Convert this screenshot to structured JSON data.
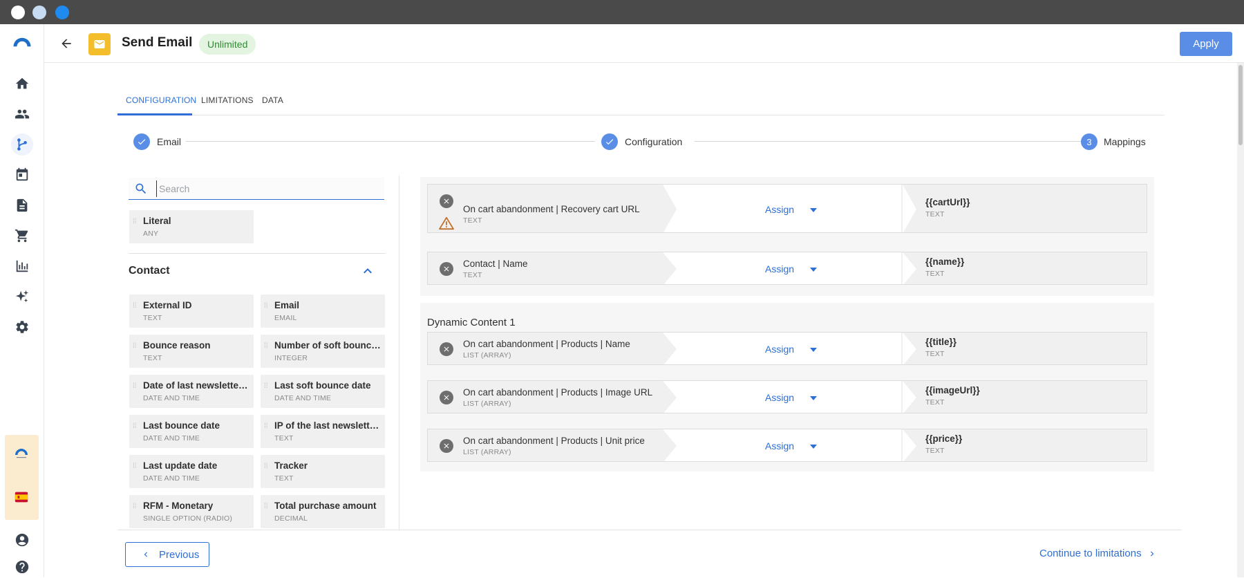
{
  "header": {
    "title": "Send Email",
    "badge": "Unlimited",
    "apply_label": "Apply"
  },
  "tabs": [
    {
      "label": "CONFIGURATION",
      "active": true
    },
    {
      "label": "LIMITATIONS",
      "active": false
    },
    {
      "label": "DATA",
      "active": false
    }
  ],
  "stepper": {
    "steps": [
      {
        "label": "Email",
        "state": "done"
      },
      {
        "label": "Configuration",
        "state": "done"
      },
      {
        "label": "Mappings",
        "state": "current",
        "number": "3"
      }
    ]
  },
  "search": {
    "placeholder": "Search",
    "value": ""
  },
  "literal": {
    "name": "Literal",
    "type": "ANY"
  },
  "contact_section": {
    "title": "Contact",
    "fields": [
      {
        "name": "External ID",
        "type": "TEXT"
      },
      {
        "name": "Email",
        "type": "EMAIL"
      },
      {
        "name": "Bounce reason",
        "type": "TEXT"
      },
      {
        "name": "Number of soft bounces",
        "type": "INTEGER"
      },
      {
        "name": "Date of last newsletter…",
        "type": "DATE AND TIME"
      },
      {
        "name": "Last soft bounce date",
        "type": "DATE AND TIME"
      },
      {
        "name": "Last bounce date",
        "type": "DATE AND TIME"
      },
      {
        "name": "IP of the last newslette…",
        "type": "TEXT"
      },
      {
        "name": "Last update date",
        "type": "DATE AND TIME"
      },
      {
        "name": "Tracker",
        "type": "TEXT"
      },
      {
        "name": "RFM - Monetary",
        "type": "SINGLE OPTION (RADIO)"
      },
      {
        "name": "Total purchase amount",
        "type": "DECIMAL"
      }
    ]
  },
  "mappings": [
    {
      "source": "On cart abandonment | Recovery cart URL",
      "source_type": "TEXT",
      "action": "Assign",
      "target": "{{cartUrl}}",
      "target_type": "TEXT",
      "warning": true
    },
    {
      "source": "Contact | Name",
      "source_type": "TEXT",
      "action": "Assign",
      "target": "{{name}}",
      "target_type": "TEXT",
      "warning": false
    }
  ],
  "dynamic_content": {
    "title": "Dynamic Content 1",
    "mappings": [
      {
        "source": "On cart abandonment | Products | Name",
        "source_type": "LIST (ARRAY)",
        "action": "Assign",
        "target": "{{title}}",
        "target_type": "TEXT"
      },
      {
        "source": "On cart abandonment | Products | Image URL",
        "source_type": "LIST (ARRAY)",
        "action": "Assign",
        "target": "{{imageUrl}}",
        "target_type": "TEXT"
      },
      {
        "source": "On cart abandonment | Products | Unit price",
        "source_type": "LIST (ARRAY)",
        "action": "Assign",
        "target": "{{price}}",
        "target_type": "TEXT"
      }
    ]
  },
  "footer": {
    "previous_label": "Previous",
    "next_label": "Continue to limitations"
  },
  "colors": {
    "accent": "#2d6fd6",
    "apply": "#5a8ee6",
    "badge_bg": "#e3f5e1",
    "badge_text": "#2f8a32",
    "email_tile": "#f3bd2c",
    "warning": "#c0702a"
  },
  "icons": {
    "sidebar": [
      "logo-icon",
      "home-icon",
      "contacts-icon",
      "flows-icon",
      "calendar-icon",
      "document-icon",
      "cart-icon",
      "chart-icon",
      "sparkle-icon",
      "gear-icon",
      "account-icon",
      "flag-spain-icon",
      "profile-icon",
      "help-icon"
    ]
  }
}
